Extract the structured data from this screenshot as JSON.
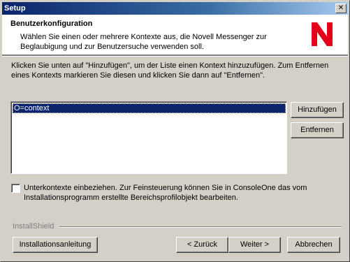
{
  "window": {
    "title": "Setup",
    "close_glyph": "✕"
  },
  "header": {
    "title": "Benutzerkonfiguration",
    "subtitle": "Wählen Sie einen oder mehrere Kontexte aus, die Novell Messenger zur Beglaubigung und zur Benutzersuche verwenden soll.",
    "logo_letter": "N",
    "logo_color": "#e4001b"
  },
  "main": {
    "instructions": "Klicken Sie unten auf \"Hinzufügen\", um der Liste einen Kontext hinzuzufügen. Zum Entfernen eines Kontexts markieren Sie diesen und klicken Sie dann auf \"Entfernen\".",
    "context_list": [
      {
        "label": "O=context",
        "selected": true
      }
    ],
    "add_button": "Hinzufügen",
    "remove_button": "Entfernen",
    "subcontexts_checkbox": {
      "checked": false,
      "label": "Unterkontexte einbeziehen. Zur Feinsteuerung können Sie in ConsoleOne das vom Installationsprogramm erstellte Bereichsprofilobjekt bearbeiten."
    }
  },
  "footer": {
    "installshield_label": "InstallShield",
    "guide_button": "Installationsanleitung",
    "back_button": "< Zurück",
    "next_button": "Weiter >",
    "cancel_button": "Abbrechen"
  }
}
